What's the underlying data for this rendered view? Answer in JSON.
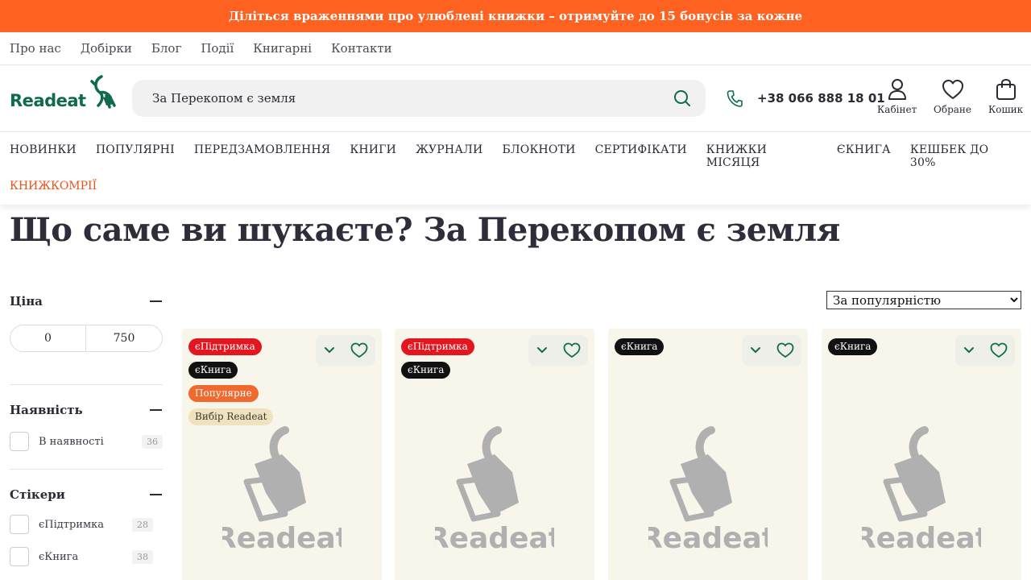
{
  "promo": {
    "text": "Діліться враженнями про улюблені книжки – отримуйте до 15 бонусів за кожне"
  },
  "topnav": [
    "Про нас",
    "Добірки",
    "Блог",
    "Події",
    "Книгарні",
    "Контакти"
  ],
  "header": {
    "logo": "Readeat",
    "search_value": "За Перекопом є земля",
    "phone": "+38 066 888 18 01",
    "account_label": "Кабінет",
    "favorites_label": "Обране",
    "cart_label": "Кошик"
  },
  "categories": [
    "НОВИНКИ",
    "ПОПУЛЯРНІ",
    "ПЕРЕДЗАМОВЛЕННЯ",
    "КНИГИ",
    "ЖУРНАЛИ",
    "БЛОКНОТИ",
    "СЕРТИФІКАТИ",
    "КНИЖКИ МІСЯЦЯ",
    "ЄКНИГА",
    "КЕШБЕК ДО 30%"
  ],
  "category_highlight": "КНИЖКОМРІЇ",
  "page_title": "Що саме ви шукаєте? За Перекопом є земля",
  "filters": {
    "price": {
      "title": "Ціна",
      "min": "0",
      "max": "750"
    },
    "availability": {
      "title": "Наявність",
      "options": [
        {
          "label": "В наявності",
          "count": "36"
        }
      ]
    },
    "stickers": {
      "title": "Стікери",
      "options": [
        {
          "label": "єПідтримка",
          "count": "28"
        },
        {
          "label": "єКнига",
          "count": "38"
        }
      ]
    }
  },
  "sort": {
    "selected": "За популярністю"
  },
  "products": [
    {
      "badges": [
        "єПідтримка",
        "єКнига",
        "Популярне",
        "Вибір Readeat"
      ],
      "placeholder": "Readeat"
    },
    {
      "badges": [
        "єПідтримка",
        "єКнига"
      ],
      "placeholder": "Readeat"
    },
    {
      "badges": [
        "єКнига"
      ],
      "placeholder": "Readeat"
    },
    {
      "badges": [
        "єКнига"
      ],
      "placeholder": "Readeat"
    }
  ],
  "colors": {
    "accent": "#ff6120",
    "brand": "#0f6b4a",
    "card_bg": "#f8f6ea"
  }
}
